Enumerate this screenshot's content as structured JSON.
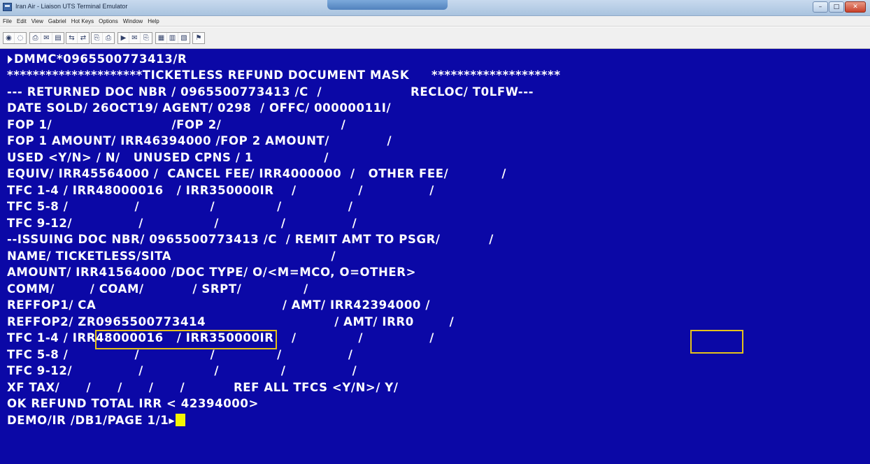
{
  "window": {
    "title": "Iran Air - Liaison UTS Terminal Emulator",
    "minimize_glyph": "–",
    "maximize_glyph": "□",
    "close_glyph": "✕"
  },
  "menu": [
    "File",
    "Edit",
    "View",
    "Gabriel",
    "Hot Keys",
    "Options",
    "Window",
    "Help"
  ],
  "toolbar_icons": {
    "g1": [
      "◉",
      "◌"
    ],
    "g2": [
      "⎙",
      "✉",
      "▤",
      "⇆",
      "⇄"
    ],
    "g3": [
      "⎘",
      "⎙"
    ],
    "g4": [
      "▶",
      "✉",
      "⎘"
    ],
    "g5": [
      "▦",
      "▥",
      "▧"
    ],
    "g6": [
      "⚑"
    ]
  },
  "terminal": {
    "colors": {
      "background": "#0b08a6",
      "text": "#ffffff",
      "cursor": "#f5f500",
      "highlight": "#e5c21a"
    },
    "lines": [
      "DMMC*0965500773413/R",
      "*********************TICKETLESS REFUND DOCUMENT MASK     ********************",
      "--- RETURNED DOC NBR / 0965500773413 /C  /                    RECLOC/ T0LFW---",
      "DATE SOLD/ 26OCT19/ AGENT/ 0298  / OFFC/ 00000011I/",
      "FOP 1/                           /FOP 2/                           /",
      "FOP 1 AMOUNT/ IRR46394000 /FOP 2 AMOUNT/             /",
      "USED <Y/N> / N/   UNUSED CPNS / 1                /",
      "EQUIV/ IRR45564000 /  CANCEL FEE/ IRR4000000  /   OTHER FEE/            /",
      "TFC 1-4 / IRR48000016   / IRR350000IR    /              /               /",
      "TFC 5-8 /               /                /              /               /",
      "TFC 9-12/               /                /              /               /",
      "--ISSUING DOC NBR/ 0965500773413 /C  / REMIT AMT TO PSGR/           /",
      "NAME/ TICKETLESS/SITA                                    /",
      "AMOUNT/ IRR41564000 /DOC TYPE/ O/<M=MCO, O=OTHER>",
      "COMM/        / COAM/           / SRPT/              /",
      "REFFOP1/ CA                                          / AMT/ IRR42394000 /",
      "REFFOP2/ ZR0965500773414                             / AMT/ IRR0        /",
      "TFC 1-4 / IRR48000016   / IRR350000IR    /              /               /",
      "TFC 5-8 /               /                /              /               /",
      "TFC 9-12/               /                /              /               /",
      "XF TAX/      /      /      /      /           REF ALL TFCS <Y/N>/ Y/",
      "OK REFUND TOTAL IRR < 42394000>",
      "DEMO/IR /DB1/PAGE 1/1"
    ],
    "last_line_marker": "▸"
  }
}
